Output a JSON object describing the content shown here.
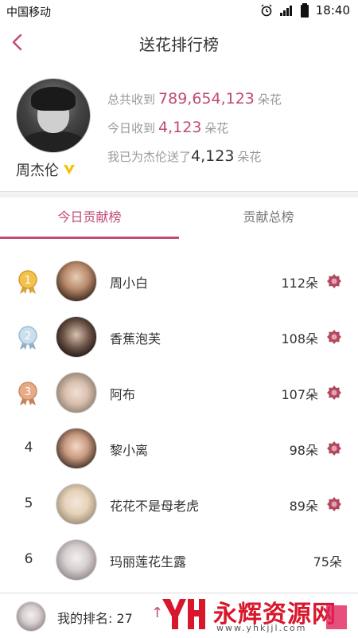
{
  "status_bar": {
    "carrier": "中国移动",
    "time": "18:40",
    "icons": [
      "alarm-icon",
      "signal-icon",
      "battery-icon"
    ]
  },
  "nav": {
    "title": "送花排行榜",
    "back_icon": "chevron-left-icon"
  },
  "profile": {
    "name": "周杰伦",
    "badge_icon": "v-badge-icon",
    "total_label": "总共收到",
    "total_value": "789,654,123",
    "total_unit": "朵花",
    "today_label": "今日收到",
    "today_value": "4,123",
    "today_unit": "朵花",
    "mine_label": "我已为杰伦送了",
    "mine_value": "4,123",
    "mine_unit": "朵花"
  },
  "tabs": [
    {
      "label": "今日贡献榜",
      "active": true
    },
    {
      "label": "贡献总榜",
      "active": false
    }
  ],
  "ranking": [
    {
      "rank": "1",
      "medal": "gold",
      "name": "周小白",
      "count": "112朵",
      "has_flower": true
    },
    {
      "rank": "2",
      "medal": "silver",
      "name": "香蕉泡芙",
      "count": "108朵",
      "has_flower": true
    },
    {
      "rank": "3",
      "medal": "bronze",
      "name": "阿布",
      "count": "107朵",
      "has_flower": true
    },
    {
      "rank": "4",
      "medal": "",
      "name": "黎小离",
      "count": "98朵",
      "has_flower": true
    },
    {
      "rank": "5",
      "medal": "",
      "name": "花花不是母老虎",
      "count": "89朵",
      "has_flower": true
    },
    {
      "rank": "6",
      "medal": "",
      "name": "玛丽莲花生露",
      "count": "75朵",
      "has_flower": false
    }
  ],
  "bottom_bar": {
    "my_rank_label": "我的排名: 27",
    "arrow": "↑"
  },
  "watermark": {
    "text": "永辉资源网",
    "url": "www.yhkjjl.com"
  },
  "colors": {
    "accent": "#c14a77",
    "gold": "#e8b33c",
    "silver": "#a9c6dc",
    "bronze": "#d69a78",
    "flower": "#b2485f"
  }
}
